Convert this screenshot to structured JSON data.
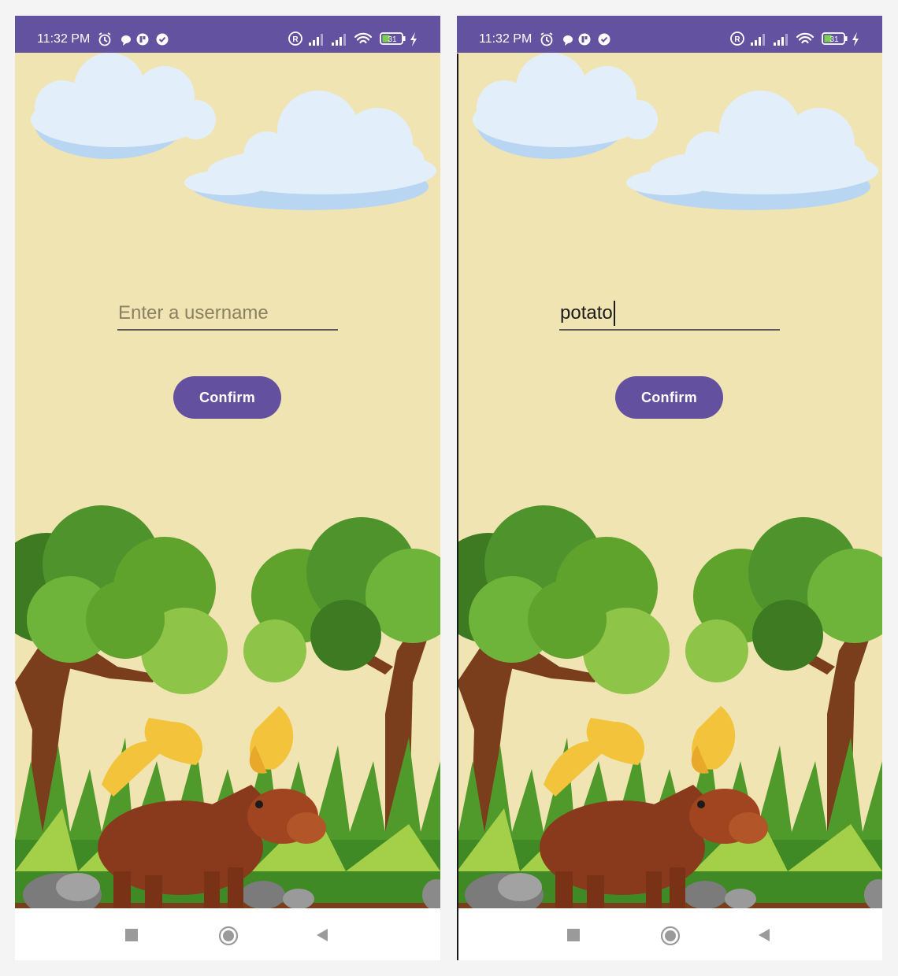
{
  "status_bar": {
    "time": "11:32 PM",
    "battery_level": "31",
    "background_color": "#6352a0",
    "left_icons": [
      "alarm-icon",
      "chat-bubble-icon",
      "app-notification-icon",
      "check-circle-icon"
    ],
    "right_icons": [
      "registered-icon",
      "signal-icon",
      "signal-icon",
      "wifi-icon",
      "battery-icon",
      "charging-icon"
    ]
  },
  "screens": [
    {
      "username_field": {
        "value": "",
        "placeholder": "Enter a username",
        "focused": false
      },
      "confirm_button": {
        "label": "Confirm"
      }
    },
    {
      "username_field": {
        "value": "potato",
        "placeholder": "Enter a username",
        "focused": true
      },
      "confirm_button": {
        "label": "Confirm"
      }
    }
  ],
  "nav_bar": {
    "icons": [
      "recents-icon",
      "home-icon",
      "back-icon"
    ]
  },
  "colors": {
    "accent": "#6351a0",
    "background": "#f0e4b2",
    "tree_green": "#5fa32c",
    "moose_brown": "#8a3a1c",
    "antler_yellow": "#f2c33b"
  }
}
